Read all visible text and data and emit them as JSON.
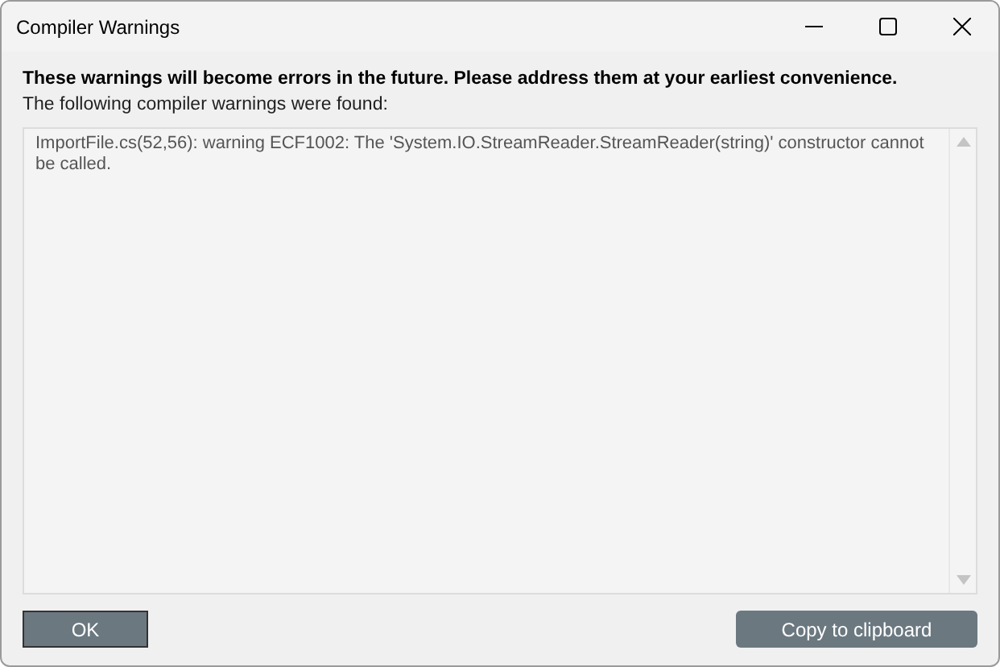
{
  "window": {
    "title": "Compiler Warnings"
  },
  "heading": "These warnings will become errors in the future. Please address them at your earliest convenience.",
  "subheading": "The following compiler warnings were found:",
  "warnings": [
    "ImportFile.cs(52,56): warning ECF1002: The 'System.IO.StreamReader.StreamReader(string)' constructor cannot be called."
  ],
  "buttons": [
    {
      "label": "OK",
      "kind": "default"
    },
    {
      "label": "Copy to clipboard",
      "kind": "normal"
    }
  ]
}
